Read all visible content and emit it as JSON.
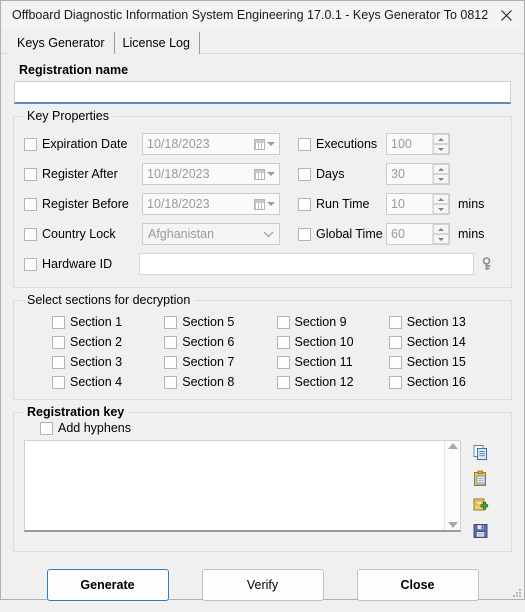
{
  "window": {
    "title": "Offboard Diagnostic Information System Engineering 17.0.1 - Keys Generator To 0812",
    "close_icon": "close-icon"
  },
  "tabs": [
    {
      "label": "Keys Generator",
      "active": true
    },
    {
      "label": "License Log",
      "active": false
    }
  ],
  "registration_name": {
    "label": "Registration name",
    "value": "",
    "placeholder": ""
  },
  "key_properties": {
    "legend": "Key Properties",
    "left_rows": [
      {
        "checkbox_label": "Expiration Date",
        "checked": false,
        "control": "datepicker",
        "value": "10/18/2023"
      },
      {
        "checkbox_label": "Register After",
        "checked": false,
        "control": "datepicker",
        "value": "10/18/2023"
      },
      {
        "checkbox_label": "Register Before",
        "checked": false,
        "control": "datepicker",
        "value": "10/18/2023"
      },
      {
        "checkbox_label": "Country Lock",
        "checked": false,
        "control": "combobox",
        "value": "Afghanistan"
      }
    ],
    "hardware_id": {
      "checkbox_label": "Hardware ID",
      "checked": false,
      "value": "",
      "icon": "key-tool-icon"
    },
    "right_rows": [
      {
        "checkbox_label": "Executions",
        "checked": false,
        "value": "100",
        "unit": ""
      },
      {
        "checkbox_label": "Days",
        "checked": false,
        "value": "30",
        "unit": ""
      },
      {
        "checkbox_label": "Run Time",
        "checked": false,
        "value": "10",
        "unit": "mins"
      },
      {
        "checkbox_label": "Global Time",
        "checked": false,
        "value": "60",
        "unit": "mins"
      }
    ]
  },
  "sections": {
    "legend": "Select sections for decryption",
    "items": [
      {
        "label": "Section 1",
        "checked": false
      },
      {
        "label": "Section 5",
        "checked": false
      },
      {
        "label": "Section 9",
        "checked": false
      },
      {
        "label": "Section 13",
        "checked": false
      },
      {
        "label": "Section 2",
        "checked": false
      },
      {
        "label": "Section 6",
        "checked": false
      },
      {
        "label": "Section 10",
        "checked": false
      },
      {
        "label": "Section 14",
        "checked": false
      },
      {
        "label": "Section 3",
        "checked": false
      },
      {
        "label": "Section 7",
        "checked": false
      },
      {
        "label": "Section 11",
        "checked": false
      },
      {
        "label": "Section 15",
        "checked": false
      },
      {
        "label": "Section 4",
        "checked": false
      },
      {
        "label": "Section 8",
        "checked": false
      },
      {
        "label": "Section 12",
        "checked": false
      },
      {
        "label": "Section 16",
        "checked": false
      }
    ]
  },
  "registration_key": {
    "legend": "Registration key",
    "add_hyphens_label": "Add hyphens",
    "add_hyphens_checked": false,
    "value": "",
    "icons": [
      {
        "name": "copy-icon"
      },
      {
        "name": "paste-icon"
      },
      {
        "name": "add-key-icon"
      },
      {
        "name": "save-icon"
      }
    ]
  },
  "footer": {
    "generate_label": "Generate",
    "verify_label": "Verify",
    "close_label": "Close"
  },
  "colors": {
    "window_bg": "#f0f0f0",
    "accent_focus": "#5a8bbd",
    "default_button_border": "#2a7fc9",
    "disabled_text": "#9a9a9a"
  }
}
